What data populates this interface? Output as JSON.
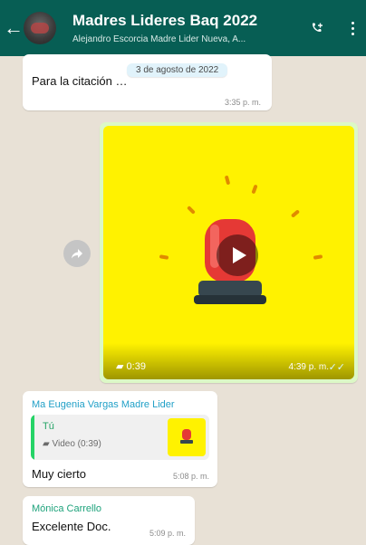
{
  "header": {
    "back_icon": "arrow-left-icon",
    "avatar_icon": "group-avatar",
    "title": "Madres Lideres Baq 2022",
    "subtitle": "Alejandro Escorcia Madre Lider Nueva, A...",
    "call_icon": "phone-plus-icon",
    "menu_icon": "more-vertical-icon"
  },
  "chat": {
    "date_chip": "3 de agosto de 2022",
    "messages": [
      {
        "text": "Para la citación …",
        "time": "3:35 p. m."
      },
      {
        "video_duration": "0:39",
        "time": "4:39 p. m.",
        "status": "✓✓"
      },
      {
        "sender": "Ma Eugenia Vargas Madre Lider",
        "reply_name": "Tú",
        "reply_text": "Video (0:39)",
        "text": "Muy cierto",
        "time": "5:08 p. m."
      },
      {
        "sender": "Mónica Carrello",
        "text": "Excelente Doc.",
        "time": "5:09 p. m."
      }
    ]
  },
  "colors": {
    "header": "#075e54",
    "chat_bg": "#e8e1d6",
    "video_bg": "#fff200",
    "siren_red": "#e53935"
  }
}
